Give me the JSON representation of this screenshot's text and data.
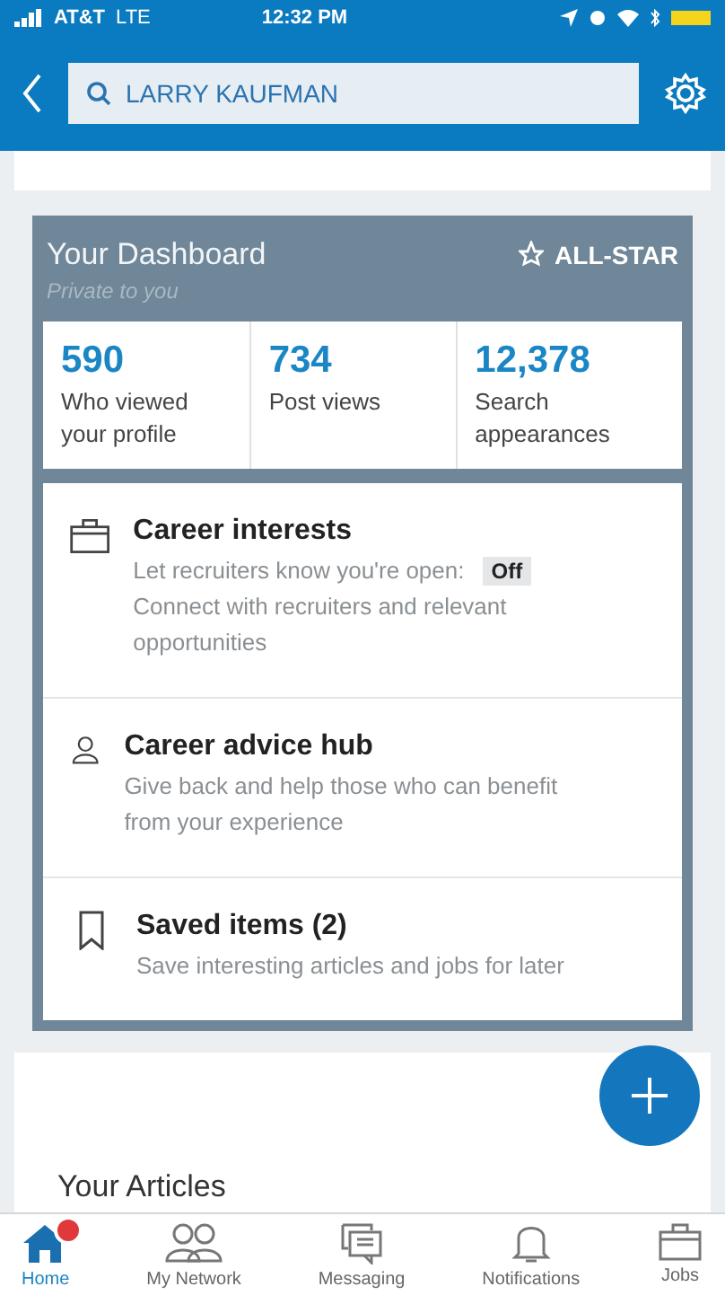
{
  "status_bar": {
    "carrier": "AT&T",
    "network": "LTE",
    "time": "12:32 PM"
  },
  "search": {
    "value": "LARRY KAUFMAN"
  },
  "dashboard": {
    "title": "Your Dashboard",
    "subtitle": "Private to you",
    "badge": "ALL-STAR",
    "stats": [
      {
        "value": "590",
        "label": "Who viewed your profile"
      },
      {
        "value": "734",
        "label": "Post views"
      },
      {
        "value": "12,378",
        "label": "Search appearances"
      }
    ],
    "items": [
      {
        "kind": "briefcase",
        "title": "Career interests",
        "line": "Let recruiters know you're open:",
        "toggle": {
          "label": "Off",
          "on": false
        },
        "description": "Connect with recruiters and relevant opportunities"
      },
      {
        "kind": "person",
        "title": "Career advice hub",
        "description": "Give back and help those who can benefit from your experience"
      },
      {
        "kind": "bookmark",
        "title": "Saved items (2)",
        "description": "Save interesting articles and jobs for later"
      }
    ]
  },
  "articles": {
    "title": "Your Articles"
  },
  "tabs": [
    {
      "kind": "home",
      "label": "Home",
      "selected": true,
      "badge": true
    },
    {
      "kind": "network",
      "label": "My Network",
      "selected": false,
      "badge": false
    },
    {
      "kind": "messaging",
      "label": "Messaging",
      "selected": false,
      "badge": false
    },
    {
      "kind": "notifications",
      "label": "Notifications",
      "selected": false,
      "badge": false
    },
    {
      "kind": "jobs",
      "label": "Jobs",
      "selected": false,
      "badge": false
    }
  ]
}
